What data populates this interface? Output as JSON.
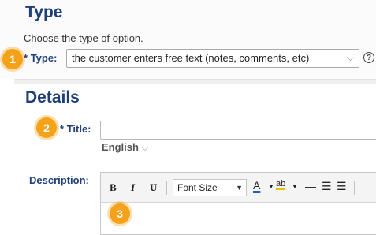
{
  "type_section": {
    "heading": "Type",
    "description": "Choose the type of option.",
    "type_field": {
      "required_marker": "*",
      "label": "Type:",
      "selected_value": "the customer enters free text (notes, comments, etc)"
    },
    "help_icon": "?"
  },
  "details_section": {
    "heading": "Details",
    "title_field": {
      "required_marker": "*",
      "label": "Title:",
      "value": "",
      "language": "English"
    },
    "description_field": {
      "label": "Description:",
      "toolbar": {
        "bold": "B",
        "italic": "I",
        "underline": "U",
        "font_size": "Font Size",
        "font_color": "A",
        "highlight": "ab",
        "horizontal_rule": "—",
        "bullet_list": "☰",
        "numbered_list": "☰"
      }
    }
  },
  "badges": [
    "1",
    "2",
    "3"
  ],
  "colors": {
    "heading": "#1f3f77",
    "badge": "#f5a21b"
  }
}
